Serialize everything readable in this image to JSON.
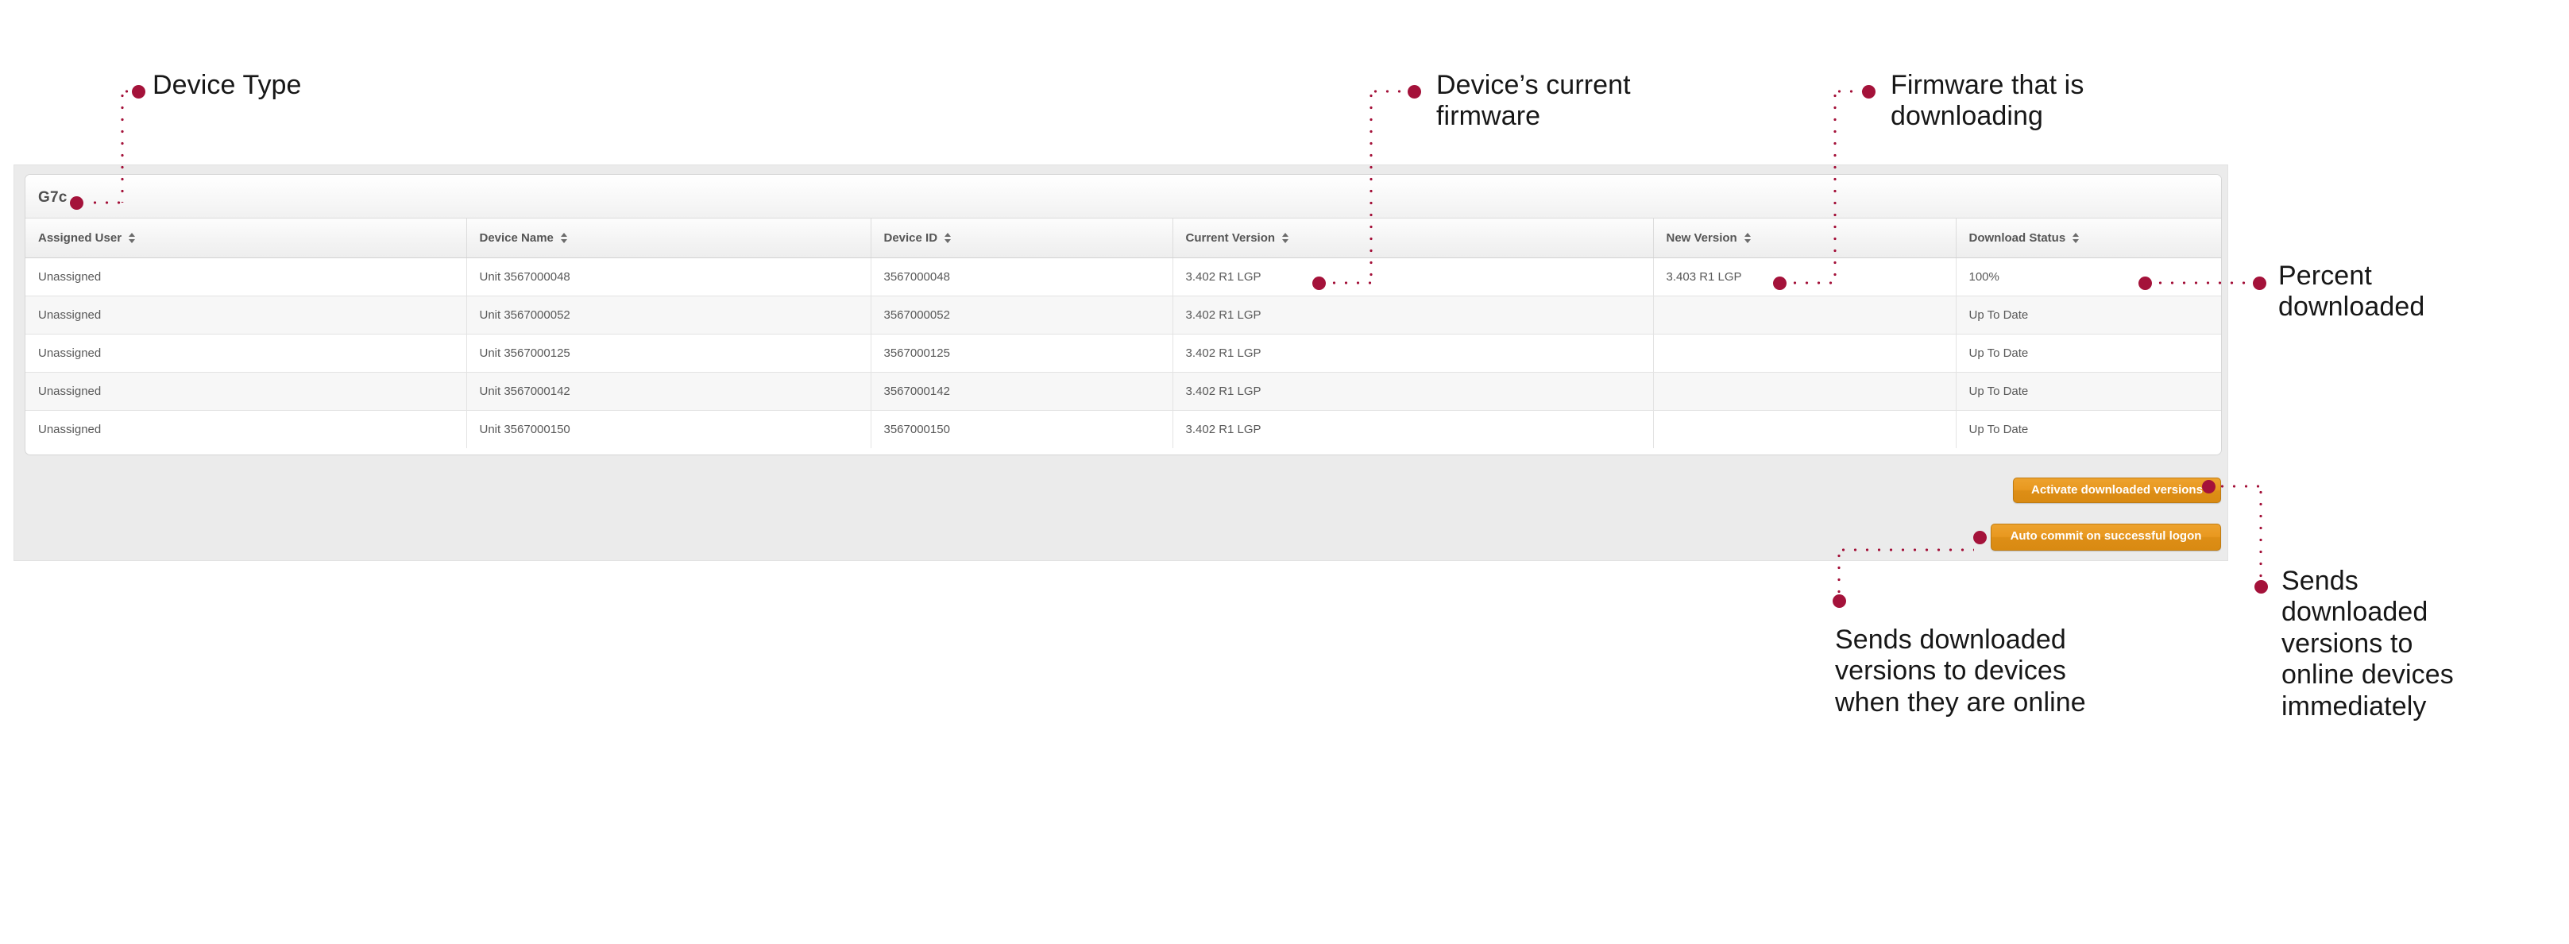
{
  "panel": {
    "card_title": "G7c",
    "columns": [
      {
        "key": "assigned_user",
        "label": "Assigned User",
        "sortable": true
      },
      {
        "key": "device_name",
        "label": "Device Name",
        "sortable": true
      },
      {
        "key": "device_id",
        "label": "Device ID",
        "sortable": true
      },
      {
        "key": "current_version",
        "label": "Current Version",
        "sortable": true
      },
      {
        "key": "new_version",
        "label": "New Version",
        "sortable": true
      },
      {
        "key": "download_status",
        "label": "Download Status",
        "sortable": true
      }
    ],
    "rows": [
      {
        "assigned_user": "Unassigned",
        "device_name": "Unit 3567000048",
        "device_id": "3567000048",
        "current_version": "3.402 R1 LGP",
        "new_version": "3.403 R1 LGP",
        "download_status": "100%",
        "download_status_state": "complete"
      },
      {
        "assigned_user": "Unassigned",
        "device_name": "Unit 3567000052",
        "device_id": "3567000052",
        "current_version": "3.402 R1 LGP",
        "new_version": "",
        "download_status": "Up To Date",
        "download_status_state": "uptodate"
      },
      {
        "assigned_user": "Unassigned",
        "device_name": "Unit 3567000125",
        "device_id": "3567000125",
        "current_version": "3.402 R1 LGP",
        "new_version": "",
        "download_status": "Up To Date",
        "download_status_state": "uptodate"
      },
      {
        "assigned_user": "Unassigned",
        "device_name": "Unit 3567000142",
        "device_id": "3567000142",
        "current_version": "3.402 R1 LGP",
        "new_version": "",
        "download_status": "Up To Date",
        "download_status_state": "uptodate"
      },
      {
        "assigned_user": "Unassigned",
        "device_name": "Unit 3567000150",
        "device_id": "3567000150",
        "current_version": "3.402 R1 LGP",
        "new_version": "",
        "download_status": "Up To Date",
        "download_status_state": "uptodate"
      }
    ],
    "buttons": {
      "activate": "Activate downloaded versions",
      "auto_commit": "Auto commit on successful logon"
    }
  },
  "annotations": [
    {
      "id": "device-type",
      "text": "Device Type"
    },
    {
      "id": "current-firmware",
      "text": "Device’s current\nfirmware"
    },
    {
      "id": "downloading",
      "text": "Firmware that is\ndownloading"
    },
    {
      "id": "percent-downloaded",
      "text": "Percent\ndownloaded"
    },
    {
      "id": "auto-commit-note",
      "text": "Sends downloaded\nversions to devices\nwhen they are online"
    },
    {
      "id": "activate-note",
      "text": "Sends\ndownloaded\nversions to\nonline devices\nimmediately"
    }
  ],
  "colors": {
    "annotation": "#a4123a",
    "button": "#e3941c",
    "status_complete": "#4aa83d",
    "panel_background": "#ebebeb"
  }
}
